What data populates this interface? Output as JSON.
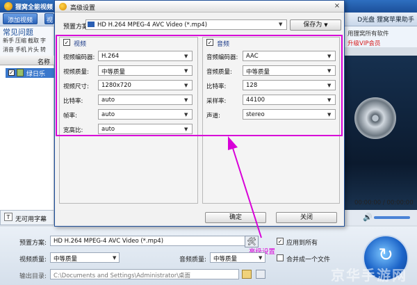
{
  "app": {
    "title": "狸窝全能视频",
    "toolbar": {
      "add_video": "添加视频",
      "edit": "视"
    },
    "right_links": "D光盘   狸窝苹果助手",
    "faq": {
      "title": "常见问题",
      "links_row1": [
        "新手",
        "压缩",
        "截取",
        "字"
      ],
      "links_row2": [
        "消音",
        "手机",
        "片头",
        "转"
      ]
    },
    "promo": {
      "line1": "用狸窝所有软件",
      "line2": "升级VIP会员"
    },
    "list": {
      "header_name": "名称",
      "item_label": "绿日乐"
    },
    "subtitle": "无可用字幕",
    "time_readout": "00:00:00 / 00:00:00",
    "bottom": {
      "preset_label": "预置方案:",
      "preset_value": "HD H.264 MPEG-4 AVC Video (*.mp4)",
      "apply_all": "应用到所有",
      "video_quality_label": "视频质量:",
      "video_quality_value": "中等质量",
      "audio_quality_label": "音频质量:",
      "audio_quality_value": "中等质量",
      "merge_label": "合并成一个文件",
      "output_label": "输出目录:",
      "output_value": "C:\\Documents and Settings\\Administrator\\桌面",
      "adv_hint": "高级设置"
    },
    "watermark": "京华手游网"
  },
  "dialog": {
    "title": "高级设置",
    "close_glyph": "×",
    "preset_label": "预置方案:",
    "preset_value": "HD H.264 MPEG-4 AVC Video (*.mp4)",
    "save_as": "保存为",
    "video": {
      "header": "视频",
      "fields": [
        {
          "label": "视频编码器:",
          "value": "H.264"
        },
        {
          "label": "视频质量:",
          "value": "中等质量"
        },
        {
          "label": "视频尺寸:",
          "value": "1280x720"
        },
        {
          "label": "比特率:",
          "value": "auto"
        },
        {
          "label": "帧率:",
          "value": "auto"
        },
        {
          "label": "宽高比:",
          "value": "auto"
        }
      ]
    },
    "audio": {
      "header": "音频",
      "fields": [
        {
          "label": "音频编码器:",
          "value": "AAC"
        },
        {
          "label": "音频质量:",
          "value": "中等质量"
        },
        {
          "label": "比特率:",
          "value": "128"
        },
        {
          "label": "采样率:",
          "value": "44100"
        },
        {
          "label": "声道:",
          "value": "stereo"
        }
      ]
    },
    "ok": "确定",
    "close": "关闭"
  },
  "colors": {
    "accent": "#2b5fb3",
    "highlight": "#d800d8"
  },
  "icons": [
    "film-reel-icon",
    "tools-icon",
    "convert-icon",
    "volume-icon",
    "subtitle-icon"
  ]
}
